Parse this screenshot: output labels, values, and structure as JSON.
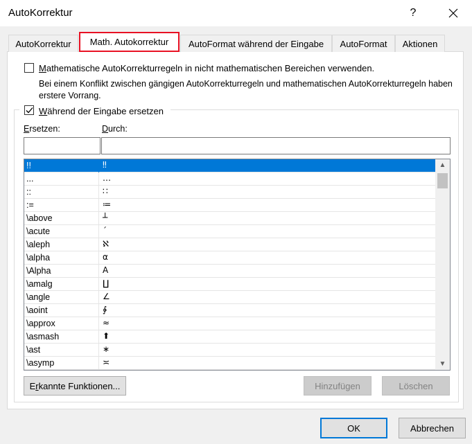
{
  "window": {
    "title": "AutoKorrektur",
    "help_label": "?"
  },
  "tabs": [
    {
      "label": "AutoKorrektur"
    },
    {
      "label": "Math. Autokorrektur"
    },
    {
      "label": "AutoFormat während der Eingabe"
    },
    {
      "label": "AutoFormat"
    },
    {
      "label": "Aktionen"
    }
  ],
  "options": {
    "use_outside_math": {
      "checked": false,
      "label_u": "M",
      "label_rest": "athematische AutoKorrekturregeln in nicht mathematischen Bereichen verwenden."
    },
    "conflict_note": "Bei einem Konflikt zwischen gängigen AutoKorrekturregeln und mathematischen AutoKorrekturregeln haben erstere Vorrang.",
    "replace_while_typing": {
      "checked": true,
      "label_u": "W",
      "label_rest": "ährend der Eingabe ersetzen"
    }
  },
  "replace": {
    "label_u": "E",
    "label_rest": "rsetzen:",
    "value": ""
  },
  "with": {
    "label_u": "D",
    "label_rest": "urch:",
    "value": ""
  },
  "entries": [
    {
      "replace": "!!",
      "with": "‼",
      "selected": true
    },
    {
      "replace": "...",
      "with": "…"
    },
    {
      "replace": "::",
      "with": "∷"
    },
    {
      "replace": ":=",
      "with": "≔"
    },
    {
      "replace": "\\above",
      "with": "┴"
    },
    {
      "replace": "\\acute",
      "with": "´"
    },
    {
      "replace": "\\aleph",
      "with": "ℵ"
    },
    {
      "replace": "\\alpha",
      "with": "α"
    },
    {
      "replace": "\\Alpha",
      "with": "Α"
    },
    {
      "replace": "\\amalg",
      "with": "∐"
    },
    {
      "replace": "\\angle",
      "with": "∠"
    },
    {
      "replace": "\\aoint",
      "with": "∳"
    },
    {
      "replace": "\\approx",
      "with": "≈"
    },
    {
      "replace": "\\asmash",
      "with": "⬆"
    },
    {
      "replace": "\\ast",
      "with": "∗"
    },
    {
      "replace": "\\asymp",
      "with": "≍"
    }
  ],
  "buttons": {
    "recognized_functions_u": "r",
    "recognized_functions_pre": "E",
    "recognized_functions_post": "kannte Funktionen...",
    "add": "Hinzufügen",
    "delete": "Löschen",
    "ok": "OK",
    "cancel": "Abbrechen"
  }
}
